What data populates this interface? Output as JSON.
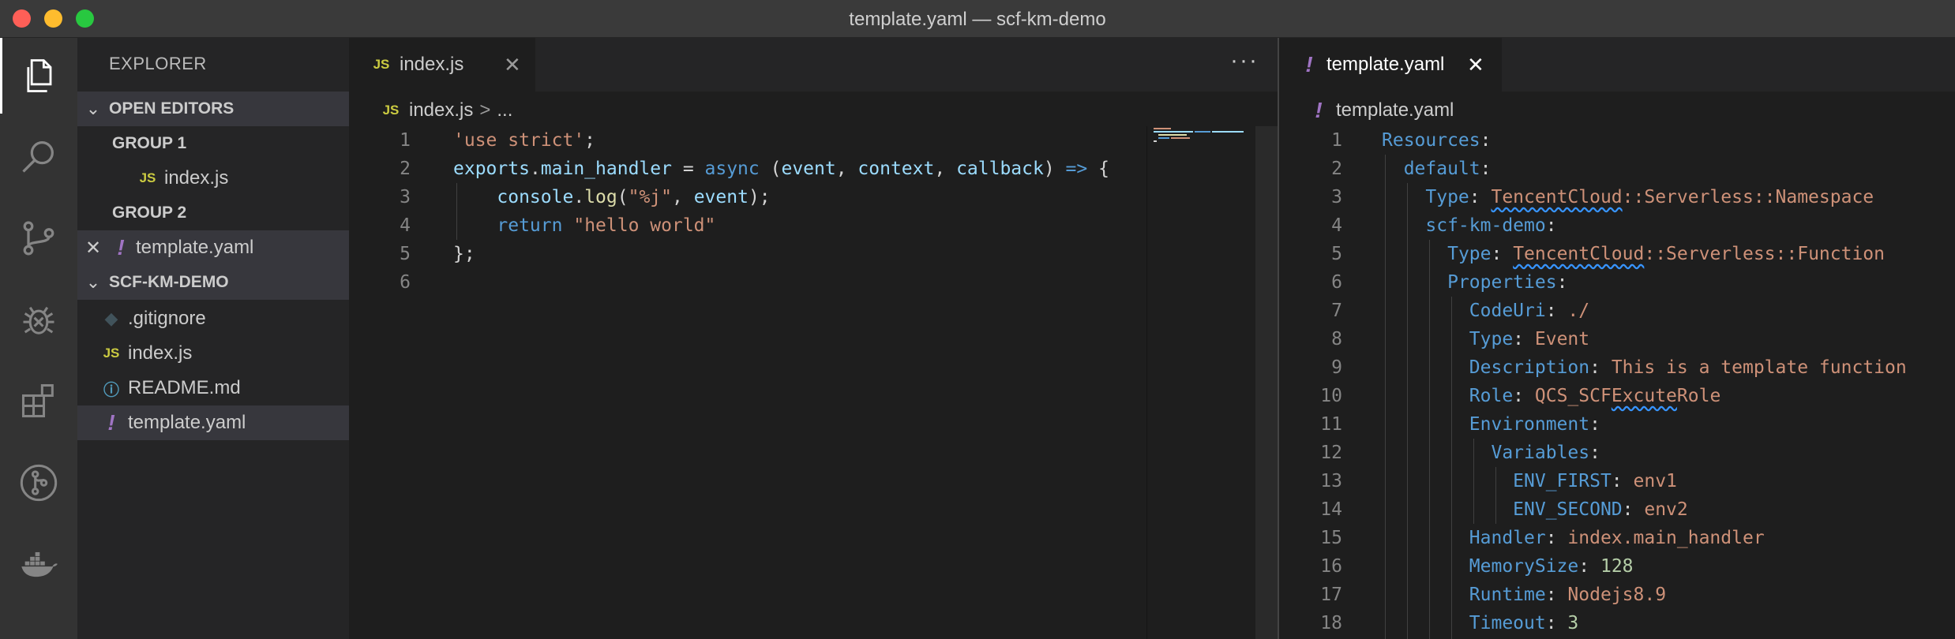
{
  "window": {
    "title": "template.yaml — scf-km-demo"
  },
  "activity_bar": [
    "explorer-icon",
    "search-icon",
    "source-control-icon",
    "debug-icon",
    "extensions-icon",
    "git-graph-icon",
    "docker-icon"
  ],
  "sidebar": {
    "title": "EXPLORER",
    "open_editors": {
      "label": "OPEN EDITORS",
      "group1": {
        "label": "GROUP 1",
        "file": "index.js"
      },
      "group2": {
        "label": "GROUP 2",
        "file": "template.yaml"
      }
    },
    "project": {
      "label": "SCF-KM-DEMO",
      "files": [
        ".gitignore",
        "index.js",
        "README.md",
        "template.yaml"
      ]
    },
    "icon_labels": {
      "js": "JS",
      "yaml": "!"
    }
  },
  "editor1": {
    "tab": "index.js",
    "more": "···",
    "breadcrumb": {
      "file": "index.js",
      "sep": ">",
      "rest": "..."
    },
    "line_numbers": [
      "1",
      "2",
      "3",
      "4",
      "5",
      "6"
    ],
    "lines": [
      [
        {
          "t": "'use strict'",
          "c": "str"
        },
        {
          "t": ";",
          "c": "plain"
        }
      ],
      [
        {
          "t": "exports",
          "c": "var"
        },
        {
          "t": ".",
          "c": "plain"
        },
        {
          "t": "main_handler",
          "c": "var"
        },
        {
          "t": " = ",
          "c": "plain"
        },
        {
          "t": "async",
          "c": "kw"
        },
        {
          "t": " (",
          "c": "plain"
        },
        {
          "t": "event",
          "c": "var"
        },
        {
          "t": ", ",
          "c": "plain"
        },
        {
          "t": "context",
          "c": "var"
        },
        {
          "t": ", ",
          "c": "plain"
        },
        {
          "t": "callback",
          "c": "var"
        },
        {
          "t": ") ",
          "c": "plain"
        },
        {
          "t": "=>",
          "c": "kw"
        },
        {
          "t": " {",
          "c": "plain"
        }
      ],
      [
        {
          "t": "    ",
          "c": "plain"
        },
        {
          "t": "console",
          "c": "var"
        },
        {
          "t": ".",
          "c": "plain"
        },
        {
          "t": "log",
          "c": "fn"
        },
        {
          "t": "(",
          "c": "plain"
        },
        {
          "t": "\"%j\"",
          "c": "str"
        },
        {
          "t": ", ",
          "c": "plain"
        },
        {
          "t": "event",
          "c": "var"
        },
        {
          "t": ");",
          "c": "plain"
        }
      ],
      [
        {
          "t": "    ",
          "c": "plain"
        },
        {
          "t": "return",
          "c": "kw"
        },
        {
          "t": " ",
          "c": "plain"
        },
        {
          "t": "\"hello world\"",
          "c": "str"
        }
      ],
      [
        {
          "t": "};",
          "c": "plain"
        }
      ],
      []
    ]
  },
  "editor2": {
    "tab": "template.yaml",
    "breadcrumb": {
      "file": "template.yaml"
    },
    "line_numbers": [
      "1",
      "2",
      "3",
      "4",
      "5",
      "6",
      "7",
      "8",
      "9",
      "10",
      "11",
      "12",
      "13",
      "14",
      "15",
      "16",
      "17",
      "18"
    ],
    "lines": [
      [
        {
          "t": "Resources",
          "c": "kw"
        },
        {
          "t": ":",
          "c": "plain"
        }
      ],
      [
        {
          "t": "  ",
          "c": "plain"
        },
        {
          "t": "default",
          "c": "kw"
        },
        {
          "t": ":",
          "c": "plain"
        }
      ],
      [
        {
          "t": "    ",
          "c": "plain"
        },
        {
          "t": "Type",
          "c": "kw"
        },
        {
          "t": ": ",
          "c": "plain"
        },
        {
          "t": "TencentCloud",
          "c": "str sq"
        },
        {
          "t": "::Serverless::Namespace",
          "c": "str"
        }
      ],
      [
        {
          "t": "    ",
          "c": "plain"
        },
        {
          "t": "scf-km-demo",
          "c": "kw"
        },
        {
          "t": ":",
          "c": "plain"
        }
      ],
      [
        {
          "t": "      ",
          "c": "plain"
        },
        {
          "t": "Type",
          "c": "kw"
        },
        {
          "t": ": ",
          "c": "plain"
        },
        {
          "t": "TencentCloud",
          "c": "str sq"
        },
        {
          "t": "::Serverless::Function",
          "c": "str"
        }
      ],
      [
        {
          "t": "      ",
          "c": "plain"
        },
        {
          "t": "Properties",
          "c": "kw"
        },
        {
          "t": ":",
          "c": "plain"
        }
      ],
      [
        {
          "t": "        ",
          "c": "plain"
        },
        {
          "t": "CodeUri",
          "c": "kw"
        },
        {
          "t": ": ",
          "c": "plain"
        },
        {
          "t": "./",
          "c": "str"
        }
      ],
      [
        {
          "t": "        ",
          "c": "plain"
        },
        {
          "t": "Type",
          "c": "kw"
        },
        {
          "t": ": ",
          "c": "plain"
        },
        {
          "t": "Event",
          "c": "str"
        }
      ],
      [
        {
          "t": "        ",
          "c": "plain"
        },
        {
          "t": "Description",
          "c": "kw"
        },
        {
          "t": ": ",
          "c": "plain"
        },
        {
          "t": "This is a template function",
          "c": "str"
        }
      ],
      [
        {
          "t": "        ",
          "c": "plain"
        },
        {
          "t": "Role",
          "c": "kw"
        },
        {
          "t": ": ",
          "c": "plain"
        },
        {
          "t": "QCS_SCF",
          "c": "str"
        },
        {
          "t": "Excute",
          "c": "str sq"
        },
        {
          "t": "Role",
          "c": "str"
        }
      ],
      [
        {
          "t": "        ",
          "c": "plain"
        },
        {
          "t": "Environment",
          "c": "kw"
        },
        {
          "t": ":",
          "c": "plain"
        }
      ],
      [
        {
          "t": "          ",
          "c": "plain"
        },
        {
          "t": "Variables",
          "c": "kw"
        },
        {
          "t": ":",
          "c": "plain"
        }
      ],
      [
        {
          "t": "            ",
          "c": "plain"
        },
        {
          "t": "ENV_FIRST",
          "c": "kw"
        },
        {
          "t": ": ",
          "c": "plain"
        },
        {
          "t": "env1",
          "c": "str"
        }
      ],
      [
        {
          "t": "            ",
          "c": "plain"
        },
        {
          "t": "ENV_SECOND",
          "c": "kw"
        },
        {
          "t": ": ",
          "c": "plain"
        },
        {
          "t": "env2",
          "c": "str"
        }
      ],
      [
        {
          "t": "        ",
          "c": "plain"
        },
        {
          "t": "Handler",
          "c": "kw"
        },
        {
          "t": ": ",
          "c": "plain"
        },
        {
          "t": "index.main_handler",
          "c": "str"
        }
      ],
      [
        {
          "t": "        ",
          "c": "plain"
        },
        {
          "t": "MemorySize",
          "c": "kw"
        },
        {
          "t": ": ",
          "c": "plain"
        },
        {
          "t": "128",
          "c": "num"
        }
      ],
      [
        {
          "t": "        ",
          "c": "plain"
        },
        {
          "t": "Runtime",
          "c": "kw"
        },
        {
          "t": ": ",
          "c": "plain"
        },
        {
          "t": "Nodejs8.9",
          "c": "str"
        }
      ],
      [
        {
          "t": "        ",
          "c": "plain"
        },
        {
          "t": "Timeout",
          "c": "kw"
        },
        {
          "t": ": ",
          "c": "plain"
        },
        {
          "t": "3",
          "c": "num"
        }
      ]
    ]
  },
  "colors": {
    "string": "#ce9178",
    "keyword": "#569cd6",
    "variable": "#9cdcfe",
    "function": "#dcdcaa",
    "number": "#b5cea8",
    "js_icon": "#cbcb41",
    "yaml_icon": "#a074c4"
  }
}
